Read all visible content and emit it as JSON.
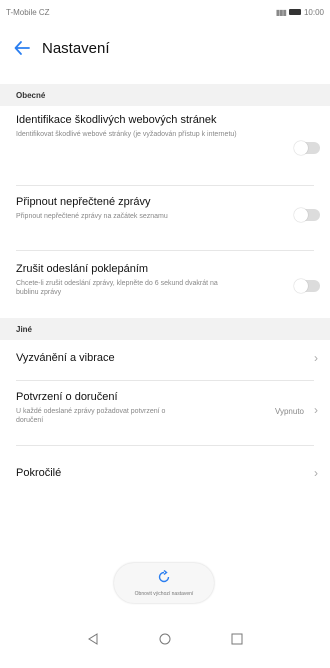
{
  "status": {
    "carrier": "T-Mobile CZ",
    "time": "10:00"
  },
  "header": {
    "back_icon": "back-arrow-icon",
    "title": "Nastavení"
  },
  "sections": {
    "general": {
      "label": "Obecné",
      "items": [
        {
          "title": "Identifikace škodlivých webových stránek",
          "subtitle": "Identifikovat škodlivé webové stránky (je vyžadován přístup k internetu)",
          "toggle": "off"
        },
        {
          "title": "Připnout nepřečtené zprávy",
          "subtitle": "Připnout nepřečtené zprávy na začátek seznamu",
          "toggle": "off"
        },
        {
          "title": "Zrušit odeslání poklepáním",
          "subtitle": "Chcete-li zrušit odeslání zprávy, klepněte do 6 sekund dvakrát na bublinu zprávy",
          "toggle": "off"
        }
      ]
    },
    "other": {
      "label": "Jiné",
      "items": [
        {
          "title": "Vyzvánění a vibrace"
        },
        {
          "title": "Potvrzení o doručení",
          "subtitle": "U každé odeslané zprávy požadovat potvrzení o doručení",
          "value": "Vypnuto"
        },
        {
          "title": "Pokročilé"
        }
      ]
    }
  },
  "reset_button": {
    "icon": "reset-icon",
    "label": "Obnovit výchozí nastavení"
  },
  "nav": {
    "back_icon": "nav-back-icon",
    "home_icon": "nav-home-icon",
    "recents_icon": "nav-recents-icon"
  }
}
